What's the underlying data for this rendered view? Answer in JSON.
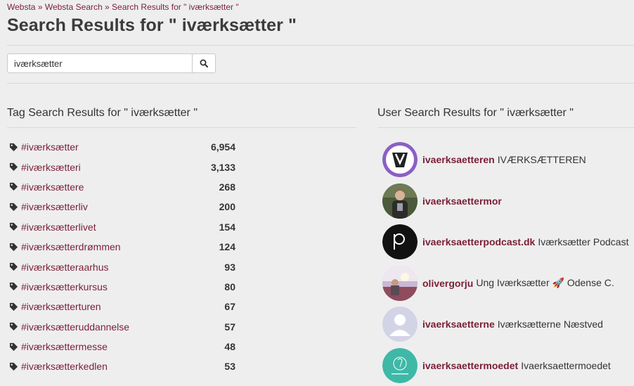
{
  "breadcrumb": {
    "items": [
      "Websta",
      "Websta Search",
      "Search Results for \" iværksætter \""
    ],
    "separator": "»"
  },
  "page_title": "Search Results for \" iværksætter \"",
  "search": {
    "value": "iværksætter",
    "button_icon": "search-icon"
  },
  "tag_section": {
    "title": "Tag Search Results for \" iværksætter \"",
    "icon": "tag-icon",
    "items": [
      {
        "tag": "#iværksætter",
        "count": "6,954"
      },
      {
        "tag": "#iværksætteri",
        "count": "3,133"
      },
      {
        "tag": "#iværksættere",
        "count": "268"
      },
      {
        "tag": "#iværksætterliv",
        "count": "200"
      },
      {
        "tag": "#iværksætterlivet",
        "count": "154"
      },
      {
        "tag": "#iværksætterdrømmen",
        "count": "124"
      },
      {
        "tag": "#iværksætteraarhus",
        "count": "93"
      },
      {
        "tag": "#iværksætterkursus",
        "count": "80"
      },
      {
        "tag": "#iværksætterturen",
        "count": "67"
      },
      {
        "tag": "#iværksætteruddannelse",
        "count": "57"
      },
      {
        "tag": "#iværksættermesse",
        "count": "48"
      },
      {
        "tag": "#iværksætterkedlen",
        "count": "53"
      }
    ]
  },
  "user_section": {
    "title": "User Search Results for \" iværksætter \"",
    "items": [
      {
        "username": "ivaerksaetteren",
        "description": "IVÆRKSÆTTEREN"
      },
      {
        "username": "ivaerksaettermor",
        "description": ""
      },
      {
        "username": "ivaerksaetterpodcast.dk",
        "description": "Iværksætter Podcast"
      },
      {
        "username": "olivergorju",
        "description": "Ung Iværksætter 🚀 Odense C."
      },
      {
        "username": "ivaerksaetterne",
        "description": "Iværksætterne Næstved"
      },
      {
        "username": "ivaerksaettermoedet",
        "description": "Ivaerksaettermoedet"
      }
    ]
  },
  "colors": {
    "link": "#7a1f35",
    "background": "#eeeeef",
    "text": "#333333"
  }
}
